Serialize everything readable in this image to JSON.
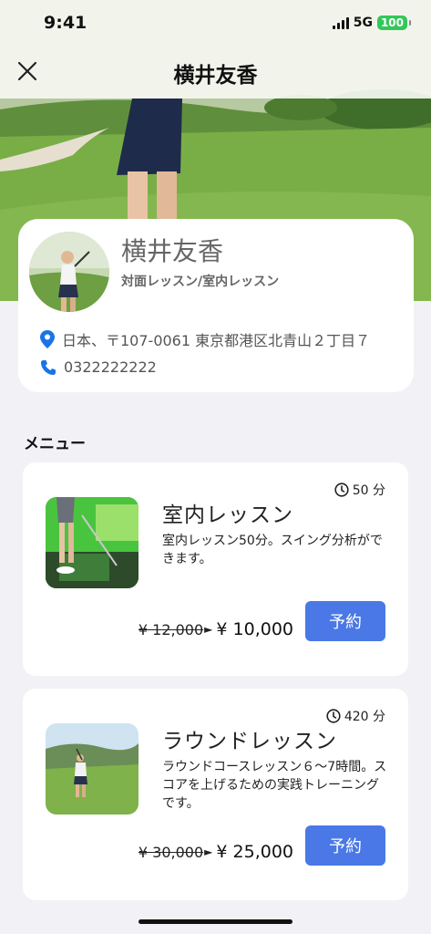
{
  "status_bar": {
    "time": "9:41",
    "network": "5G",
    "battery": "100"
  },
  "header": {
    "title": "横井友香",
    "close_icon": "close-icon"
  },
  "profile": {
    "name": "横井友香",
    "lesson_types": "対面レッスン/室内レッスン",
    "address": "日本、〒107-0061 東京都港区北青山２丁目７",
    "phone": "0322222222",
    "icons": {
      "address": "location-pin-icon",
      "phone": "phone-icon"
    }
  },
  "menu": {
    "heading": "メニュー",
    "items": [
      {
        "title": "室内レッスン",
        "duration": "50 分",
        "description": "室内レッスン50分。スイング分析ができます。",
        "old_price": "¥ 12,000",
        "new_price": "¥ 10,000",
        "button": "予約"
      },
      {
        "title": "ラウンドレッスン",
        "duration": "420 分",
        "description": "ラウンドコースレッスン６〜7時間。スコアを上げるための実践トレーニングです。",
        "old_price": "¥ 30,000",
        "new_price": "¥ 25,000",
        "button": "予約"
      }
    ]
  },
  "colors": {
    "accent": "#4a78e6",
    "battery": "#34c759",
    "icon_blue": "#1a73e8",
    "background": "#f2f2f6"
  }
}
